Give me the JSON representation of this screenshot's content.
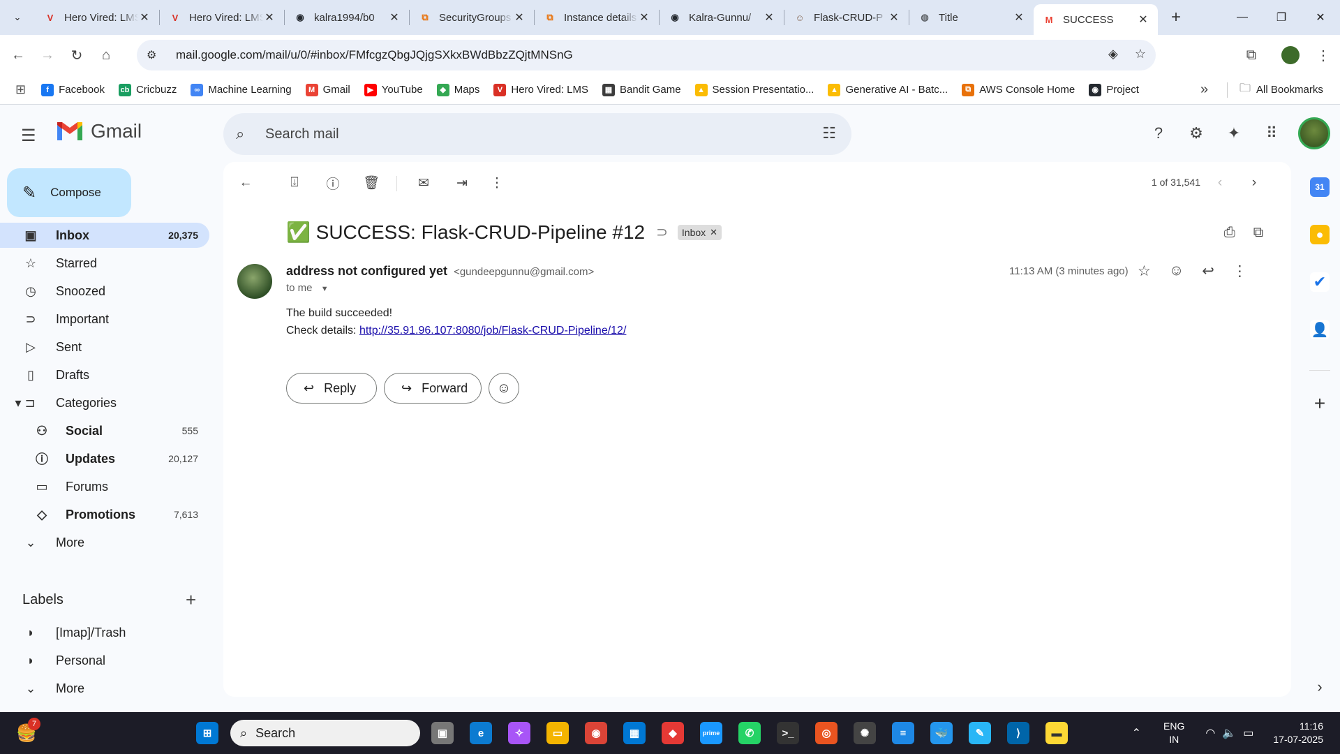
{
  "browser": {
    "tabs": [
      {
        "title": "Hero Vired: LMS",
        "favicon": "V",
        "color": "#d93025",
        "close": "✕"
      },
      {
        "title": "Hero Vired: LMS",
        "favicon": "V",
        "color": "#d93025",
        "close": "✕"
      },
      {
        "title": "kalra1994/b0",
        "favicon": "◉",
        "color": "#24292f",
        "close": "✕"
      },
      {
        "title": "SecurityGroups",
        "favicon": "⧉",
        "color": "#e8710a",
        "close": "✕"
      },
      {
        "title": "Instance details",
        "favicon": "⧉",
        "color": "#e8710a",
        "close": "✕"
      },
      {
        "title": "Kalra-Gunnu/",
        "favicon": "◉",
        "color": "#24292f",
        "close": "✕"
      },
      {
        "title": "Flask-CRUD-P",
        "favicon": "☺",
        "color": "#8a6d5a",
        "close": "✕"
      },
      {
        "title": "Title",
        "favicon": "◍",
        "color": "#5f6368",
        "close": "✕"
      },
      {
        "title": "SUCCESS",
        "favicon": "M",
        "color": "#ea4335",
        "close": "✕",
        "active": true
      }
    ],
    "new_tab": "+",
    "url": "mail.google.com/mail/u/0/#inbox/FMfcgzQbgJQjgSXkxBWdBbzZQjtMNSnG",
    "bookmarks": [
      {
        "label": "Facebook",
        "icon": "f",
        "color": "#1877f2"
      },
      {
        "label": "Cricbuzz",
        "icon": "cb",
        "color": "#1a9e61"
      },
      {
        "label": "Machine Learning",
        "icon": "∞",
        "color": "#4285f4"
      },
      {
        "label": "Gmail",
        "icon": "M",
        "color": "#ea4335"
      },
      {
        "label": "YouTube",
        "icon": "▶",
        "color": "#ff0000"
      },
      {
        "label": "Maps",
        "icon": "◆",
        "color": "#34a853"
      },
      {
        "label": "Hero Vired: LMS",
        "icon": "V",
        "color": "#d93025"
      },
      {
        "label": "Bandit Game",
        "icon": "▦",
        "color": "#3c3c3c"
      },
      {
        "label": "Session Presentatio...",
        "icon": "▲",
        "color": "#fbbc04"
      },
      {
        "label": "Generative AI - Batc...",
        "icon": "▲",
        "color": "#fbbc04"
      },
      {
        "label": "AWS Console Home",
        "icon": "⧉",
        "color": "#e8710a"
      },
      {
        "label": "Project",
        "icon": "◉",
        "color": "#24292f"
      }
    ],
    "more_bookmarks": "»",
    "all_bookmarks": "All Bookmarks"
  },
  "gmail": {
    "app_name": "Gmail",
    "search_placeholder": "Search mail",
    "compose_label": "Compose",
    "nav": [
      {
        "label": "Inbox",
        "icon": "inbox-icon",
        "glyph": "▣",
        "count": "20,375",
        "active": true
      },
      {
        "label": "Starred",
        "icon": "star-icon",
        "glyph": "☆",
        "count": ""
      },
      {
        "label": "Snoozed",
        "icon": "clock-icon",
        "glyph": "◷",
        "count": ""
      },
      {
        "label": "Important",
        "icon": "important-icon",
        "glyph": "⊃",
        "count": ""
      },
      {
        "label": "Sent",
        "icon": "send-icon",
        "glyph": "▷",
        "count": ""
      },
      {
        "label": "Drafts",
        "icon": "draft-icon",
        "glyph": "▯",
        "count": ""
      },
      {
        "label": "Categories",
        "icon": "label-icon",
        "glyph": "▾ ⊐",
        "count": ""
      }
    ],
    "categories": [
      {
        "label": "Social",
        "icon": "people-icon",
        "glyph": "⚇",
        "count": "555",
        "bold": true
      },
      {
        "label": "Updates",
        "icon": "info-icon",
        "glyph": "ⓘ",
        "count": "20,127",
        "bold": true
      },
      {
        "label": "Forums",
        "icon": "forum-icon",
        "glyph": "▭",
        "count": "",
        "bold": false
      },
      {
        "label": "Promotions",
        "icon": "tag-icon",
        "glyph": "◇",
        "count": "7,613",
        "bold": true
      }
    ],
    "more_label": "More",
    "labels_header": "Labels",
    "labels": [
      {
        "label": "[Imap]/Trash"
      },
      {
        "label": "Personal"
      }
    ],
    "labels_more": "More",
    "pager": "1 of 31,541",
    "email": {
      "subject": "✅ SUCCESS: Flask-CRUD-Pipeline #12",
      "chip": "Inbox",
      "sender_name": "address not configured yet",
      "sender_email": "<gundeepgunnu@gmail.com>",
      "to": "to me",
      "time": "11:13 AM (3 minutes ago)",
      "body_line1": "The build succeeded!",
      "body_prefix": "Check details:",
      "body_link": "http://35.91.96.107:8080/job/Flask-CRUD-Pipeline/12/",
      "reply": "Reply",
      "forward": "Forward"
    }
  },
  "taskbar": {
    "search": "Search",
    "lang1": "ENG",
    "lang2": "IN",
    "time": "11:16",
    "date": "17-07-2025",
    "badge": "7"
  }
}
